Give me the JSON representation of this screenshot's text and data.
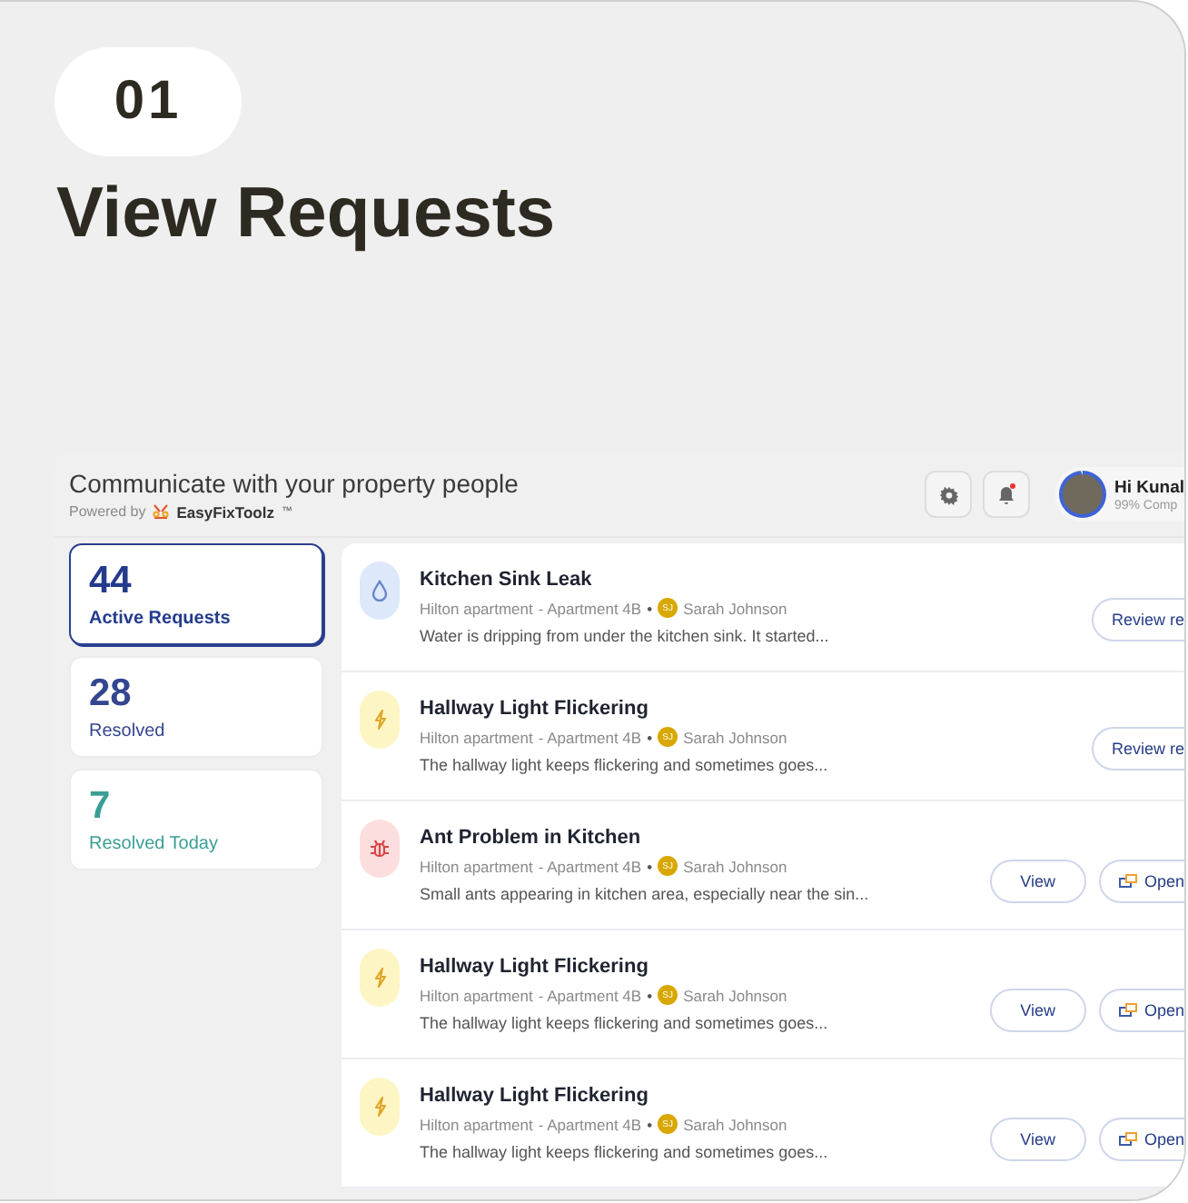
{
  "step": {
    "number": "01",
    "title": "View Requests"
  },
  "app": {
    "header": {
      "title": "Communicate with your property people",
      "powered_by": "Powered by",
      "brand": "EasyFixToolz",
      "brand_mark": "™",
      "notifications_unread": true,
      "user_greeting": "Hi Kunal",
      "user_progress": "99% Comp",
      "profile_completion": {
        "level": 0.99
      }
    },
    "stats": [
      {
        "value": "44",
        "label": "Active Requests",
        "selected": true,
        "color": "#243b8c"
      },
      {
        "value": "28",
        "label": "Resolved",
        "selected": false,
        "color": "#33468f"
      },
      {
        "value": "7",
        "label": "Resolved Today",
        "selected": false,
        "color": "#3a9e94"
      }
    ],
    "requests": [
      {
        "kind": "water",
        "title": "Kitchen Sink Leak",
        "property": "Hilton apartment",
        "unit": "- Apartment 4B",
        "separator": "•",
        "initials": "SJ",
        "tenant": "Sarah Johnson",
        "description": "Water is dripping from under the kitchen sink. It started...",
        "actions": [
          {
            "kind": "review",
            "label": "Review re"
          }
        ]
      },
      {
        "kind": "electric",
        "title": "Hallway Light Flickering",
        "property": "Hilton apartment",
        "unit": "- Apartment 4B",
        "separator": "•",
        "initials": "SJ",
        "tenant": "Sarah Johnson",
        "description": "The hallway light keeps flickering and sometimes goes...",
        "actions": [
          {
            "kind": "review",
            "label": "Review re"
          }
        ]
      },
      {
        "kind": "pest",
        "title": "Ant Problem in Kitchen",
        "property": "Hilton apartment",
        "unit": "- Apartment 4B",
        "separator": "•",
        "initials": "SJ",
        "tenant": "Sarah Johnson",
        "description": "Small ants appearing in kitchen area, especially near the sin...",
        "actions": [
          {
            "kind": "view",
            "label": "View"
          },
          {
            "kind": "open",
            "label": "Open"
          }
        ]
      },
      {
        "kind": "electric",
        "title": "Hallway Light Flickering",
        "property": "Hilton apartment",
        "unit": "- Apartment 4B",
        "separator": "•",
        "initials": "SJ",
        "tenant": "Sarah Johnson",
        "description": "The hallway light keeps flickering and sometimes goes...",
        "actions": [
          {
            "kind": "view",
            "label": "View"
          },
          {
            "kind": "open",
            "label": "Open"
          }
        ]
      },
      {
        "kind": "electric",
        "title": "Hallway Light Flickering",
        "property": "Hilton apartment",
        "unit": "- Apartment 4B",
        "separator": "•",
        "initials": "SJ",
        "tenant": "Sarah Johnson",
        "description": "The hallway light keeps flickering and sometimes goes...",
        "actions": [
          {
            "kind": "view",
            "label": "View"
          },
          {
            "kind": "open",
            "label": "Open"
          }
        ]
      }
    ]
  }
}
